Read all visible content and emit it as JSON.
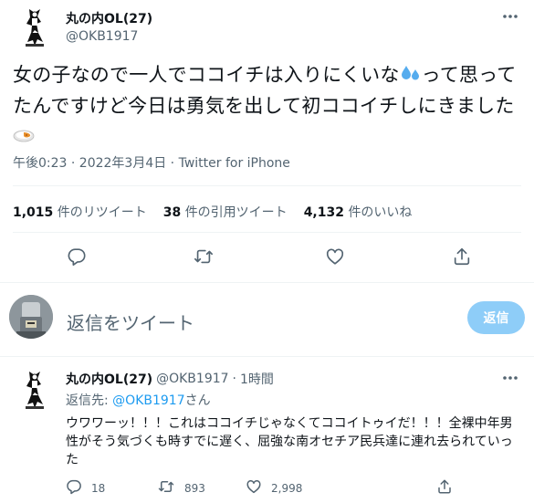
{
  "main_tweet": {
    "display_name": "丸の内OL(27)",
    "handle": "@OKB1917",
    "text_part1": "女の子なので一人でココイチは入りにくいな",
    "text_part2": "って思ってたんですけど今日は勇気を出して初ココイチしにきました",
    "emoji_1": "sweat-droplets-icon",
    "emoji_2": "curry-rice-icon",
    "timestamp": "午後0:23 · 2022年3月4日",
    "separator": " · ",
    "source": "Twitter for iPhone"
  },
  "stats": {
    "retweets_count": "1,015",
    "retweets_label": "件のリツイート",
    "quotes_count": "38",
    "quotes_label": "件の引用ツイート",
    "likes_count": "4,132",
    "likes_label": "件のいいね"
  },
  "compose": {
    "placeholder": "返信をツイート",
    "button_label": "返信"
  },
  "reply_tweet": {
    "display_name": "丸の内OL(27)",
    "handle": "@OKB1917",
    "dot": "·",
    "time": "1時間",
    "replying_prefix": "返信先: ",
    "replying_mention": "@OKB1917",
    "replying_suffix": "さん",
    "text": "ウワワーッ！！！これはココイチじゃなくてココイトゥイだ！！！全裸中年男性がそう気づくも時すでに遅く、屈強な南オセチア民兵達に連れ去られていった",
    "reply_count": "18",
    "retweet_count": "893",
    "like_count": "2,998"
  },
  "colors": {
    "text": "#0f1419",
    "secondary": "#536471",
    "accent": "#1d9bf0",
    "button_disabled": "#8ecdf8",
    "divider": "#eff3f4"
  }
}
